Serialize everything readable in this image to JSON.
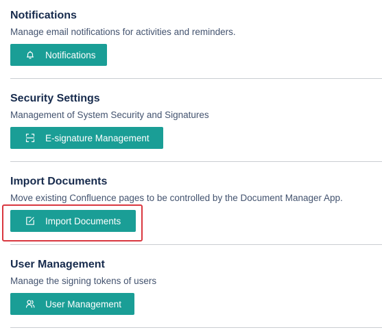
{
  "sections": [
    {
      "title": "Notifications",
      "description": "Manage email notifications for activities and reminders.",
      "button_label": "Notifications",
      "button_icon": "bell-icon"
    },
    {
      "title": "Security Settings",
      "description": "Management of System Security and Signatures",
      "button_label": "E-signature Management",
      "button_icon": "scan-icon"
    },
    {
      "title": "Import Documents",
      "description": "Move existing Confluence pages to be controlled by the Document Manager App.",
      "button_label": "Import Documents",
      "button_icon": "edit-import-icon"
    },
    {
      "title": "User Management",
      "description": "Manage the signing tokens of users",
      "button_label": "User Management",
      "button_icon": "users-icon"
    }
  ],
  "colors": {
    "button_bg": "#1a9e96",
    "heading": "#172b4d",
    "description": "#42526e",
    "divider": "#c9ccd1",
    "highlight": "#d9363e"
  }
}
